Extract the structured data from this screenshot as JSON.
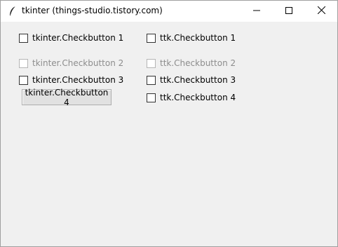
{
  "window": {
    "title": "tkinter (things-studio.tistory.com)",
    "controls": {
      "minimize": "minimize-icon",
      "maximize": "maximize-icon",
      "close": "close-icon"
    },
    "app_icon": "feather-icon"
  },
  "left_column": {
    "cb1": {
      "label": "tkinter.Checkbutton 1",
      "checked": false,
      "enabled": true
    },
    "cb2": {
      "label": "tkinter.Checkbutton 2",
      "checked": false,
      "enabled": false
    },
    "cb3": {
      "label": "tkinter.Checkbutton 3",
      "checked": false,
      "enabled": true
    },
    "cb4": {
      "label": "tkinter.Checkbutton 4",
      "style": "button"
    }
  },
  "right_column": {
    "cb1": {
      "label": "ttk.Checkbutton 1",
      "checked": false,
      "enabled": true
    },
    "cb2": {
      "label": "ttk.Checkbutton 2",
      "checked": false,
      "enabled": false
    },
    "cb3": {
      "label": "ttk.Checkbutton 3",
      "checked": false,
      "enabled": true
    },
    "cb4": {
      "label": "ttk.Checkbutton 4",
      "checked": false,
      "enabled": true
    }
  }
}
